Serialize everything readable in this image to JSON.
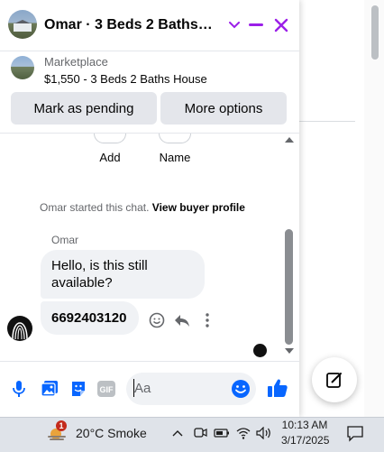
{
  "chat": {
    "title": "Omar · 3 Beds 2 Baths Ho...",
    "listing": {
      "source": "Marketplace",
      "price_title": "$1,550 - 3 Beds 2 Baths House"
    },
    "buttons": {
      "mark_pending": "Mark as pending",
      "more_options": "More options"
    },
    "quick_actions": {
      "add": "Add",
      "name": "Name"
    },
    "system_message": {
      "text": "Omar started this chat.",
      "link": "View buyer profile"
    },
    "messages": {
      "sender": "Omar",
      "first": "Hello, is this still available?",
      "second": "6692403120"
    },
    "composer": {
      "placeholder": "Aa"
    }
  },
  "taskbar": {
    "weather_badge": "1",
    "weather": "20°C  Smoke",
    "time": "10:13 AM",
    "date": "3/17/2025"
  },
  "colors": {
    "accent": "#9b1fe8",
    "messenger_blue": "#0866ff"
  }
}
